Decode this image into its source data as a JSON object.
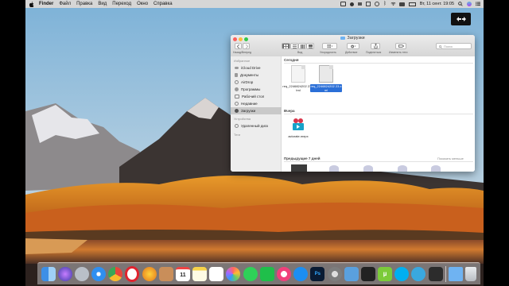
{
  "menubar": {
    "app": "Finder",
    "items": [
      "Файл",
      "Правка",
      "Вид",
      "Переход",
      "Окно",
      "Справка"
    ],
    "clock": "Вт, 11 сент.  19:05"
  },
  "finder": {
    "title": "Загрузки",
    "toolbar": {
      "nav_label": "Назад/Вперед",
      "view_label": "Вид",
      "arrange_label": "Упорядочить",
      "action_label": "Действие",
      "share_label": "Поделиться",
      "tags_label": "Изменить теги",
      "search_placeholder": "Поиск"
    },
    "sidebar": {
      "favorites_heading": "Избранное",
      "favorites": [
        "iCloud Drive",
        "Документы",
        "AirDrop",
        "Программы",
        "Рабочий стол",
        "Недавние",
        "Загрузки"
      ],
      "devices_heading": "Устройства",
      "devices": [
        "Удаленный диск"
      ],
      "tags_heading": "Теги"
    },
    "sections": {
      "today": "Сегодня",
      "yesterday": "Вчера",
      "previous7": "Предыдущие 7 дней",
      "show_all": "Показать меньше"
    },
    "files_today": [
      {
        "name": "req_2246824202 23.html"
      },
      {
        "name": "req_2246824202 23.xml"
      }
    ],
    "files_yesterday": [
      {
        "name": "actorate.mepx"
      }
    ]
  },
  "dock": {
    "calendar_day": "11"
  }
}
